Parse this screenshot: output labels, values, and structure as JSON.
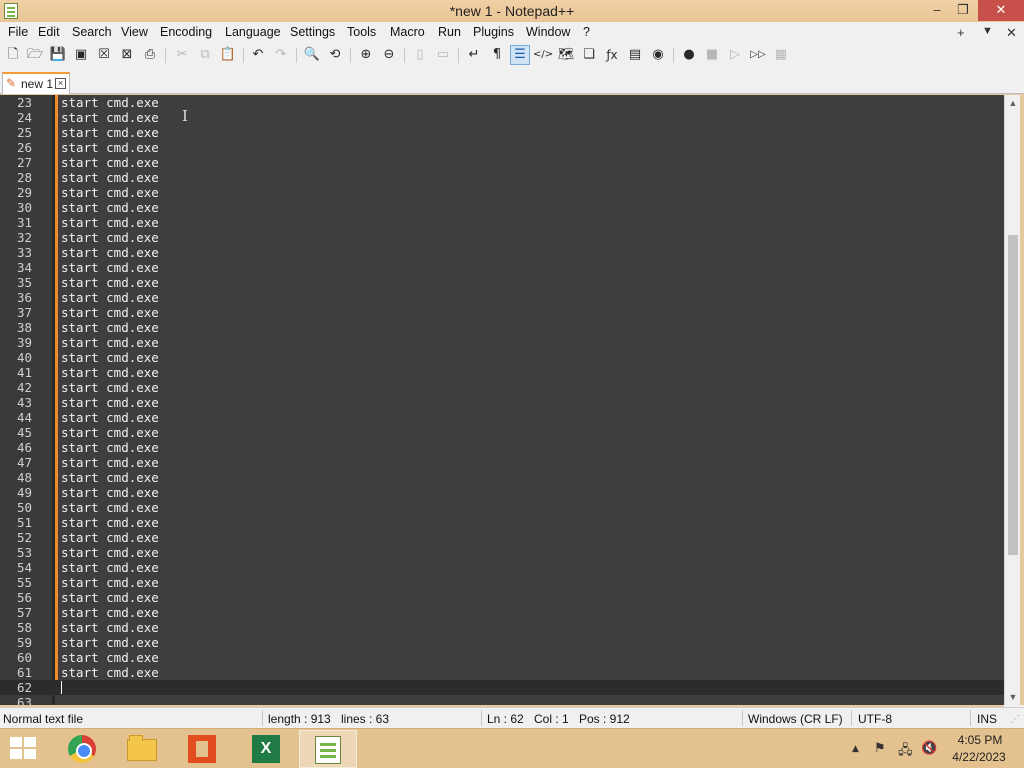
{
  "window": {
    "title": "*new 1 - Notepad++",
    "min_glyph": "–",
    "max_glyph": "❐",
    "close_glyph": "✕"
  },
  "menu": {
    "items": [
      "File",
      "Edit",
      "Search",
      "View",
      "Encoding",
      "Language",
      "Settings",
      "Tools",
      "Macro",
      "Run",
      "Plugins",
      "Window",
      "?"
    ],
    "right": [
      "+",
      "▼",
      "✕"
    ]
  },
  "toolbar": {
    "icons": [
      {
        "name": "new-file-icon",
        "glyph": "🗋",
        "enabled": true
      },
      {
        "name": "open-file-icon",
        "glyph": "🗁",
        "enabled": true
      },
      {
        "name": "save-icon",
        "glyph": "💾",
        "enabled": true
      },
      {
        "name": "save-all-icon",
        "glyph": "▣",
        "enabled": true
      },
      {
        "name": "close-icon",
        "glyph": "☒",
        "enabled": true
      },
      {
        "name": "close-all-icon",
        "glyph": "⊠",
        "enabled": true
      },
      {
        "name": "print-icon",
        "glyph": "⎙",
        "enabled": true
      },
      {
        "name": "cut-icon",
        "glyph": "✂",
        "enabled": false
      },
      {
        "name": "copy-icon",
        "glyph": "⧉",
        "enabled": false
      },
      {
        "name": "paste-icon",
        "glyph": "📋",
        "enabled": true
      },
      {
        "name": "undo-icon",
        "glyph": "↶",
        "enabled": true
      },
      {
        "name": "redo-icon",
        "glyph": "↷",
        "enabled": false
      },
      {
        "name": "find-icon",
        "glyph": "🔍",
        "enabled": true
      },
      {
        "name": "replace-icon",
        "glyph": "⟲",
        "enabled": true
      },
      {
        "name": "zoom-in-icon",
        "glyph": "⊕",
        "enabled": true
      },
      {
        "name": "zoom-out-icon",
        "glyph": "⊖",
        "enabled": true
      },
      {
        "name": "sync-vertical-icon",
        "glyph": "▯",
        "enabled": false
      },
      {
        "name": "sync-horizontal-icon",
        "glyph": "▭",
        "enabled": false
      },
      {
        "name": "word-wrap-icon",
        "glyph": "↵",
        "enabled": true
      },
      {
        "name": "show-all-characters-icon",
        "glyph": "¶",
        "enabled": true
      },
      {
        "name": "indent-guide-icon",
        "glyph": "☰",
        "enabled": true,
        "active": true
      },
      {
        "name": "xml-tag-icon",
        "glyph": "</>",
        "enabled": true
      },
      {
        "name": "document-map-icon",
        "glyph": "🗺",
        "enabled": true
      },
      {
        "name": "document-list-icon",
        "glyph": "❏",
        "enabled": true
      },
      {
        "name": "function-list-icon",
        "glyph": "ƒx",
        "enabled": true
      },
      {
        "name": "folder-as-workspace-icon",
        "glyph": "▤",
        "enabled": true
      },
      {
        "name": "monitoring-icon",
        "glyph": "◉",
        "enabled": true
      },
      {
        "name": "record-macro-icon",
        "glyph": "●",
        "enabled": true
      },
      {
        "name": "stop-macro-icon",
        "glyph": "■",
        "enabled": false
      },
      {
        "name": "play-macro-icon",
        "glyph": "▷",
        "enabled": false
      },
      {
        "name": "run-macro-multiple-icon",
        "glyph": "▷▷",
        "enabled": true
      },
      {
        "name": "save-macro-icon",
        "glyph": "▦",
        "enabled": false
      }
    ]
  },
  "tab": {
    "label": "new 1",
    "close_glyph": "×"
  },
  "editor": {
    "code_line": "start cmd.exe",
    "lines": [
      {
        "n": "23",
        "text": "start cmd.exe"
      },
      {
        "n": "24",
        "text": "start cmd.exe"
      },
      {
        "n": "25",
        "text": "start cmd.exe"
      },
      {
        "n": "26",
        "text": "start cmd.exe"
      },
      {
        "n": "27",
        "text": "start cmd.exe"
      },
      {
        "n": "28",
        "text": "start cmd.exe"
      },
      {
        "n": "29",
        "text": "start cmd.exe"
      },
      {
        "n": "30",
        "text": "start cmd.exe"
      },
      {
        "n": "31",
        "text": "start cmd.exe"
      },
      {
        "n": "32",
        "text": "start cmd.exe"
      },
      {
        "n": "33",
        "text": "start cmd.exe"
      },
      {
        "n": "34",
        "text": "start cmd.exe"
      },
      {
        "n": "35",
        "text": "start cmd.exe"
      },
      {
        "n": "36",
        "text": "start cmd.exe"
      },
      {
        "n": "37",
        "text": "start cmd.exe"
      },
      {
        "n": "38",
        "text": "start cmd.exe"
      },
      {
        "n": "39",
        "text": "start cmd.exe"
      },
      {
        "n": "40",
        "text": "start cmd.exe"
      },
      {
        "n": "41",
        "text": "start cmd.exe"
      },
      {
        "n": "42",
        "text": "start cmd.exe"
      },
      {
        "n": "43",
        "text": "start cmd.exe"
      },
      {
        "n": "44",
        "text": "start cmd.exe"
      },
      {
        "n": "45",
        "text": "start cmd.exe"
      },
      {
        "n": "46",
        "text": "start cmd.exe"
      },
      {
        "n": "47",
        "text": "start cmd.exe"
      },
      {
        "n": "48",
        "text": "start cmd.exe"
      },
      {
        "n": "49",
        "text": "start cmd.exe"
      },
      {
        "n": "50",
        "text": "start cmd.exe"
      },
      {
        "n": "51",
        "text": "start cmd.exe"
      },
      {
        "n": "52",
        "text": "start cmd.exe"
      },
      {
        "n": "53",
        "text": "start cmd.exe"
      },
      {
        "n": "54",
        "text": "start cmd.exe"
      },
      {
        "n": "55",
        "text": "start cmd.exe"
      },
      {
        "n": "56",
        "text": "start cmd.exe"
      },
      {
        "n": "57",
        "text": "start cmd.exe"
      },
      {
        "n": "58",
        "text": "start cmd.exe"
      },
      {
        "n": "59",
        "text": "start cmd.exe"
      },
      {
        "n": "60",
        "text": "start cmd.exe"
      },
      {
        "n": "61",
        "text": "start cmd.exe"
      },
      {
        "n": "62",
        "text": ""
      },
      {
        "n": "63",
        "text": ""
      }
    ],
    "current_line": "62",
    "colors": {
      "background": "#3e3e3e",
      "change_marker": "#f2892e"
    }
  },
  "status": {
    "file_type": "Normal text file",
    "length": "length : 913",
    "lines": "lines : 63",
    "ln": "Ln : 62",
    "col": "Col : 1",
    "pos": "Pos : 912",
    "eol": "Windows (CR LF)",
    "encoding": "UTF-8",
    "mode": "INS"
  },
  "taskbar": {
    "apps": [
      "start-button",
      "chrome",
      "file-explorer",
      "office",
      "excel",
      "notepad-plus-plus"
    ],
    "excel_letter": "X",
    "tray_icons": [
      {
        "name": "show-hidden-icons-icon",
        "glyph": "▲"
      },
      {
        "name": "action-center-flag-icon",
        "glyph": "⚑"
      },
      {
        "name": "network-icon",
        "glyph": "🖧"
      },
      {
        "name": "volume-muted-icon",
        "glyph": "🔇"
      }
    ],
    "time": "4:05 PM",
    "date": "4/22/2023"
  }
}
